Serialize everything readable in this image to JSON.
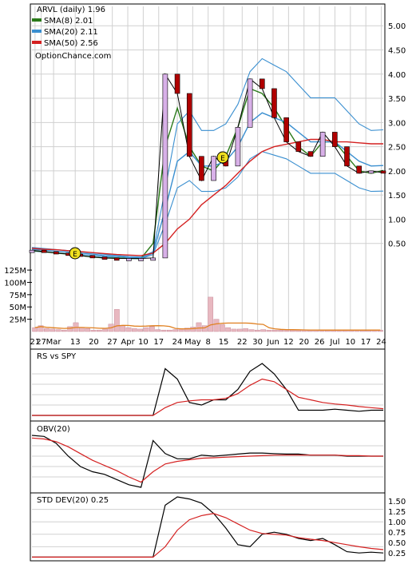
{
  "colors": {
    "price_up": "#d8b0e8",
    "price_down": "#b00000",
    "sma8": "#2a7a1a",
    "sma20": "#3a8fd0",
    "sma50": "#d42020",
    "bollinger": "#3a8fd0",
    "volume": "#e8b8c0",
    "volume_sma": "#e08020",
    "indicator": "#000000",
    "signal": "#d42020",
    "event_marker": "#f0e020",
    "grid": "#d0d0d0"
  },
  "chart_data": [
    {
      "type": "line",
      "name": "price-panel",
      "title": "ARVL (daily) 1.96",
      "watermark": "OptionChance.com",
      "legend_placement": "top-left",
      "grid": true,
      "ylim": [
        0,
        5.4
      ],
      "yticks": [
        "0.50",
        "1.00",
        "1.50",
        "2.00",
        "2.50",
        "3.00",
        "3.50",
        "4.00",
        "4.50",
        "5.00"
      ],
      "ytick_values": [
        0.5,
        1.0,
        1.5,
        2.0,
        2.5,
        3.0,
        3.5,
        4.0,
        4.5,
        5.0
      ],
      "xticks": [
        "21",
        "27",
        "Mar",
        "13",
        "20",
        "27",
        "Apr",
        "10",
        "17",
        "24",
        "May",
        "8",
        "15",
        "22",
        "30",
        "Jun",
        "12",
        "20",
        "26",
        "Jul",
        "10",
        "17",
        "24"
      ],
      "xtick_pos": [
        0.01,
        0.03,
        0.07,
        0.14,
        0.2,
        0.26,
        0.31,
        0.36,
        0.41,
        0.47,
        0.52,
        0.57,
        0.62,
        0.68,
        0.73,
        0.78,
        0.83,
        0.88,
        0.93,
        0.98,
        1.03,
        1.08,
        1.13
      ],
      "legend": [
        {
          "label": "SMA(8) 2.01",
          "color": "#2a7a1a"
        },
        {
          "label": "SMA(20) 2.11",
          "color": "#3a8fd0"
        },
        {
          "label": "SMA(50) 2.56",
          "color": "#d42020"
        }
      ],
      "series": [
        {
          "name": "SMA(8)",
          "values": [
            0.35,
            0.33,
            0.3,
            0.28,
            0.25,
            0.22,
            0.2,
            0.2,
            0.19,
            0.19,
            0.5,
            2.5,
            3.3,
            2.5,
            2.1,
            2.0,
            2.3,
            2.9,
            3.7,
            3.6,
            3.3,
            2.9,
            2.5,
            2.3,
            2.6,
            2.6,
            2.3,
            2.0,
            1.95,
            2.01
          ]
        },
        {
          "name": "SMA(20)",
          "values": [
            0.38,
            0.36,
            0.34,
            0.32,
            0.3,
            0.28,
            0.25,
            0.23,
            0.21,
            0.2,
            0.3,
            1.2,
            2.2,
            2.4,
            2.1,
            2.1,
            2.2,
            2.5,
            3.0,
            3.2,
            3.1,
            3.0,
            2.8,
            2.6,
            2.6,
            2.6,
            2.4,
            2.2,
            2.1,
            2.11
          ]
        },
        {
          "name": "SMA(50)",
          "values": [
            0.4,
            0.38,
            0.37,
            0.35,
            0.33,
            0.31,
            0.29,
            0.27,
            0.26,
            0.25,
            0.3,
            0.5,
            0.8,
            1.0,
            1.3,
            1.5,
            1.7,
            1.95,
            2.2,
            2.4,
            2.5,
            2.55,
            2.6,
            2.65,
            2.65,
            2.6,
            2.6,
            2.58,
            2.56,
            2.56
          ]
        },
        {
          "name": "Close",
          "values": [
            0.36,
            0.33,
            0.3,
            0.28,
            0.25,
            0.22,
            0.2,
            0.19,
            0.19,
            0.19,
            0.2,
            4.0,
            3.6,
            2.3,
            1.8,
            2.3,
            2.1,
            2.9,
            3.9,
            3.7,
            3.1,
            2.6,
            2.4,
            2.3,
            2.8,
            2.5,
            2.1,
            1.95,
            2.0,
            1.96
          ]
        }
      ]
    },
    {
      "type": "bar",
      "name": "volume-panel",
      "yticks": [
        "125M",
        "100M",
        "75M",
        "50M",
        "25M"
      ],
      "ytick_values": [
        125,
        100,
        75,
        50,
        25
      ],
      "ylim": [
        0,
        130
      ],
      "values": [
        8,
        12,
        6,
        5,
        4,
        3,
        10,
        18,
        8,
        6,
        3,
        3,
        5,
        15,
        45,
        12,
        8,
        6,
        5,
        8,
        10,
        4,
        3,
        3,
        4,
        5,
        7,
        9,
        18,
        12,
        70,
        25,
        14,
        8,
        5,
        5,
        6,
        4,
        3,
        4,
        3,
        3,
        3,
        3,
        3,
        3,
        3,
        3,
        3,
        3,
        3,
        3,
        3,
        3,
        3,
        3,
        3,
        3,
        3,
        3
      ]
    },
    {
      "type": "line",
      "name": "rs-panel",
      "title": "RS vs SPY",
      "series": [
        {
          "name": "RS",
          "values": [
            0.0,
            0.0,
            0.0,
            0.0,
            0.0,
            0.0,
            0.0,
            0.0,
            0.0,
            0.0,
            0.0,
            0.9,
            0.7,
            0.25,
            0.2,
            0.3,
            0.3,
            0.5,
            0.85,
            1.0,
            0.8,
            0.5,
            0.1,
            0.1,
            0.1,
            0.12,
            0.1,
            0.08,
            0.1,
            0.1
          ]
        },
        {
          "name": "Signal",
          "values": [
            0.0,
            0.0,
            0.0,
            0.0,
            0.0,
            0.0,
            0.0,
            0.0,
            0.0,
            0.0,
            0.0,
            0.15,
            0.25,
            0.28,
            0.3,
            0.3,
            0.33,
            0.42,
            0.58,
            0.7,
            0.65,
            0.5,
            0.35,
            0.3,
            0.25,
            0.22,
            0.2,
            0.17,
            0.15,
            0.13
          ]
        }
      ]
    },
    {
      "type": "line",
      "name": "obv-panel",
      "title": "OBV(20)",
      "series": [
        {
          "name": "OBV",
          "values": [
            1.0,
            0.98,
            0.85,
            0.6,
            0.4,
            0.3,
            0.25,
            0.15,
            0.05,
            0.0,
            0.9,
            0.65,
            0.55,
            0.55,
            0.62,
            0.6,
            0.62,
            0.64,
            0.66,
            0.66,
            0.65,
            0.64,
            0.64,
            0.62,
            0.62,
            0.62,
            0.6,
            0.6,
            0.6,
            0.6
          ]
        },
        {
          "name": "Signal",
          "values": [
            0.95,
            0.93,
            0.88,
            0.78,
            0.65,
            0.52,
            0.42,
            0.32,
            0.2,
            0.1,
            0.3,
            0.45,
            0.5,
            0.53,
            0.56,
            0.57,
            0.58,
            0.59,
            0.6,
            0.61,
            0.62,
            0.62,
            0.62,
            0.62,
            0.62,
            0.62,
            0.61,
            0.61,
            0.6,
            0.6
          ]
        }
      ]
    },
    {
      "type": "line",
      "name": "std-panel",
      "title": "STD DEV(20) 0.25",
      "yticks": [
        "1.50",
        "1.25",
        "1.00",
        "0.75",
        "0.50",
        "0.25"
      ],
      "ytick_values": [
        1.5,
        1.25,
        1.0,
        0.75,
        0.5,
        0.25
      ],
      "ylim": [
        0.1,
        1.6
      ],
      "series": [
        {
          "name": "STD DEV(20)",
          "values": [
            0.15,
            0.15,
            0.15,
            0.15,
            0.15,
            0.15,
            0.15,
            0.15,
            0.15,
            0.15,
            0.15,
            1.4,
            1.6,
            1.55,
            1.45,
            1.2,
            0.85,
            0.45,
            0.4,
            0.7,
            0.75,
            0.7,
            0.6,
            0.55,
            0.6,
            0.45,
            0.28,
            0.25,
            0.27,
            0.25
          ]
        },
        {
          "name": "Signal",
          "values": [
            0.15,
            0.15,
            0.15,
            0.15,
            0.15,
            0.15,
            0.15,
            0.15,
            0.15,
            0.15,
            0.15,
            0.4,
            0.8,
            1.05,
            1.15,
            1.2,
            1.1,
            0.95,
            0.8,
            0.72,
            0.7,
            0.68,
            0.62,
            0.58,
            0.55,
            0.5,
            0.45,
            0.4,
            0.36,
            0.33
          ]
        }
      ]
    }
  ]
}
